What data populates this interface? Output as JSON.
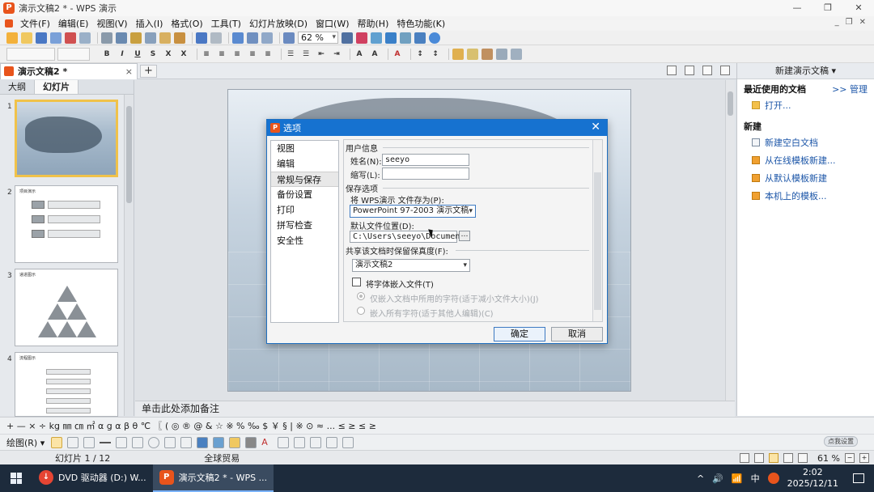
{
  "window": {
    "title": "演示文稿2 * - WPS 演示",
    "controls": [
      "—",
      "❐",
      "✕"
    ]
  },
  "menu": {
    "items": [
      "文件(F)",
      "编辑(E)",
      "视图(V)",
      "插入(I)",
      "格式(O)",
      "工具(T)",
      "幻灯片放映(D)",
      "窗口(W)",
      "帮助(H)",
      "特色功能(K)"
    ],
    "right_controls": [
      "_",
      "❐",
      "✕"
    ]
  },
  "toolbar": {
    "zoom": "62 %"
  },
  "tabs": {
    "doc_tab_label": "演示文稿2 *",
    "close": "×",
    "new_tab": "+"
  },
  "slide_panel": {
    "tabs": [
      "大纲",
      "幻灯片"
    ],
    "slides": [
      {
        "num": "1",
        "title": ""
      },
      {
        "num": "2",
        "title": "项目演示"
      },
      {
        "num": "3",
        "title": "递进图示"
      },
      {
        "num": "4",
        "title": "流程图示"
      }
    ]
  },
  "notes_placeholder": "单击此处添加备注",
  "task_pane": {
    "header": "新建演示文稿 ▾",
    "recent_title": "最近使用的文档",
    "manage": ">> 管理",
    "open": "打开...",
    "new_title": "新建",
    "links": [
      "新建空白文档",
      "从在线模板新建...",
      "从默认模板新建",
      "本机上的模板..."
    ]
  },
  "symbols": "+ — × ÷ kg ㎜ ㎝ ㎡ α g α β θ ℃ 〖 ( ◎ ® @ & ☆ ※ % ‰ $ ￥ § | ※ ⊙ ≈ ... ≤ ≥ ≤ ≥",
  "draw_bar": {
    "label": "绘图(R) ▾",
    "badge": "点我设置"
  },
  "status": {
    "slide": "幻灯片 1 / 12",
    "theme": "全球贸易",
    "zoom": "61 %"
  },
  "taskbar": {
    "items": [
      {
        "label": "DVD 驱动器 (D:) W...",
        "icon": "dvd"
      },
      {
        "label": "演示文稿2 * - WPS ...",
        "icon": "wps"
      }
    ],
    "ime": "中",
    "time": "2:02",
    "date": "2025/12/11",
    "tray_icons": [
      "^",
      "🔊",
      "📶"
    ]
  },
  "dialog": {
    "title": "选项",
    "close": "✕",
    "nav": [
      "视图",
      "编辑",
      "常规与保存",
      "备份设置",
      "打印",
      "拼写检查",
      "安全性"
    ],
    "user_info": "用户信息",
    "name_label": "姓名(N):",
    "name_value": "seeyo",
    "abbr_label": "缩写(L):",
    "abbr_value": "",
    "save_options": "保存选项",
    "save_as_label": "将 WPS演示 文件存为(P):",
    "save_as_value": "PowerPoint 97-2003 演示文稿",
    "default_loc_label": "默认文件位置(D):",
    "default_loc_value": "C:\\Users\\seeyo\\Documents",
    "browse": "…",
    "share_label": "共享该文档时保留保真度(F):",
    "share_value": "演示文稿2",
    "embed_fonts": "将字体嵌入文件(T)",
    "embed_used": "仅嵌入文档中所用的字符(适于减小文件大小)(J)",
    "embed_all": "嵌入所有字符(适于其他人编辑)(C)",
    "ok": "确定",
    "cancel": "取消"
  },
  "colors": {
    "accent": "#1672d0",
    "brand": "#e8541c",
    "taskbar": "#1d2b3c"
  }
}
